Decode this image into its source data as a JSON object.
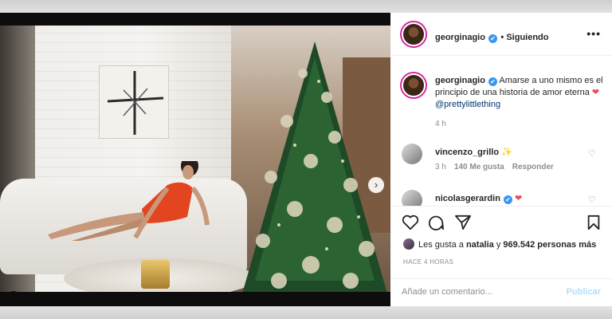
{
  "post": {
    "author": "georginagio",
    "follow_status": "Siguiendo",
    "more_label": "•••",
    "caption_text": "Amarse a uno mismo es el principio de una historia de amor eterna",
    "caption_mention": "@prettylittlething",
    "caption_time": "4 h"
  },
  "comments": [
    {
      "user": "vincenzo_grillo",
      "emoji": "✨",
      "time": "3 h",
      "likes": "140 Me gusta",
      "reply": "Responder"
    },
    {
      "user": "nicolasgerardin",
      "emoji": "❤"
    }
  ],
  "actions": {
    "liked_by_prefix": "Les gusta a",
    "liked_by_user": "natalia",
    "liked_by_middle": "y",
    "liked_by_count": "969.542",
    "liked_by_suffix": "personas más",
    "posted_ago": "HACE 4 HORAS"
  },
  "add_comment": {
    "placeholder": "Añade un comentario...",
    "publish_label": "Publicar"
  },
  "icons": {
    "verified": "✔",
    "heart": "♡",
    "heart_filled": "❤",
    "next": "›"
  },
  "colors": {
    "verified_blue": "#3897f0",
    "heart_red": "#ed4956",
    "publish_disabled": "#b2dffc",
    "mention": "#00376b"
  },
  "carousel": {
    "total": 2,
    "active": 1
  }
}
